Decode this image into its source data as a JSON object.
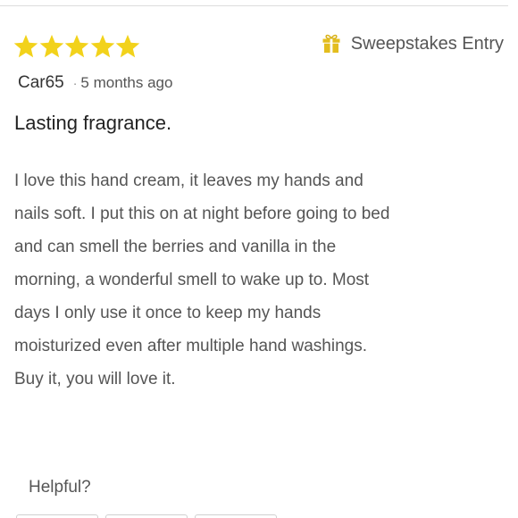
{
  "review": {
    "rating": 5,
    "max_rating": 5,
    "star_color": "#f2d21b",
    "sweepstakes_label": "Sweepstakes Entry",
    "sweepstakes_icon": "gift-icon",
    "reviewer_name": "Car65",
    "separator": "·",
    "time_ago": "5 months ago",
    "title": "Lasting fragrance.",
    "body_lines": [
      "I love this hand cream, it leaves my hands and",
      "nails soft. I put this on at night before going to bed",
      "and can smell the berries and vanilla in the",
      "morning, a wonderful smell to wake up to. Most",
      "days I only use it once to keep my hands",
      "moisturized even after multiple hand washings.",
      "Buy it, you will love it."
    ]
  },
  "feedback": {
    "helpful_label": "Helpful?"
  }
}
